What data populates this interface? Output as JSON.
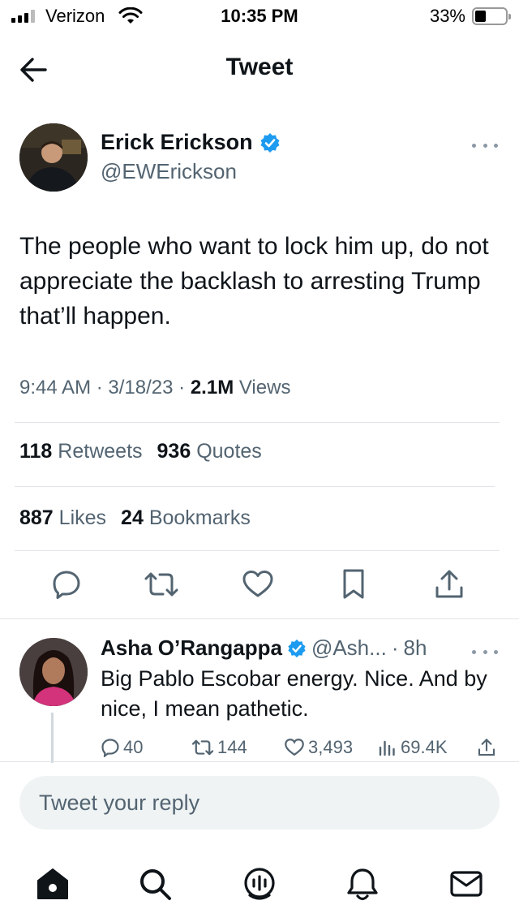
{
  "status_bar": {
    "carrier": "Verizon",
    "time": "10:35 PM",
    "battery_percent": "33%",
    "battery_level": 0.33,
    "signal_bars": 3
  },
  "header": {
    "title": "Tweet",
    "back_icon": "arrow-left-icon"
  },
  "tweet": {
    "author_name": "Erick Erickson",
    "author_handle": "@EWErickson",
    "verified": true,
    "text": "The people who want to lock him up, do not appreciate the backlash to arresting Trump that’ll happen.",
    "time": "9:44 AM",
    "date": "3/18/23",
    "views_count": "2.1M",
    "views_label": "Views",
    "separator": "·",
    "retweets_count": "118",
    "retweets_label": "Retweets",
    "quotes_count": "936",
    "quotes_label": "Quotes",
    "likes_count": "887",
    "likes_label": "Likes",
    "bookmarks_count": "24",
    "bookmarks_label": "Bookmarks",
    "actions": [
      "reply-icon",
      "retweet-icon",
      "like-icon",
      "bookmark-icon",
      "share-icon"
    ]
  },
  "reply": {
    "author_name": "Asha O’Rangappa",
    "verified": true,
    "author_handle": "@Ash...",
    "separator": "·",
    "age": "8h",
    "text": "Big Pablo Escobar energy. Nice. And by nice, I mean pathetic.",
    "replies": "40",
    "retweets": "144",
    "likes": "3,493",
    "views": "69.4K"
  },
  "compose": {
    "placeholder": "Tweet your reply"
  },
  "colors": {
    "verified_blue": "#1d9bf0",
    "text_primary": "#0f1419",
    "text_secondary": "#536471"
  },
  "bottom_nav": [
    "home-icon",
    "search-icon",
    "spaces-icon",
    "notifications-icon",
    "messages-icon"
  ]
}
